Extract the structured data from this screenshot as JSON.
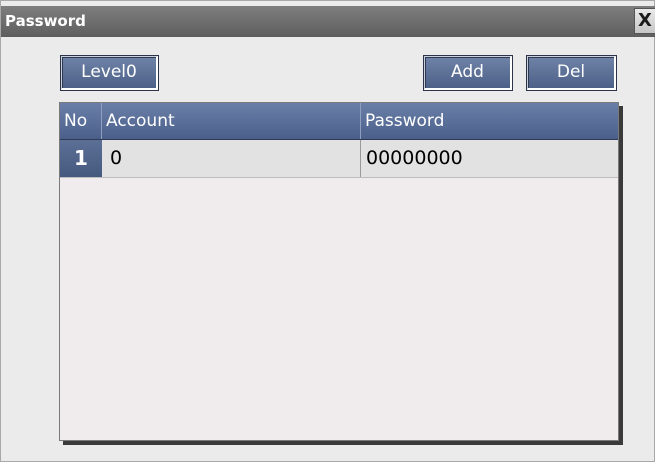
{
  "window": {
    "title": "Password",
    "close_label": "X"
  },
  "toolbar": {
    "level_label": "Level",
    "level_value": "0",
    "add_label": "Add",
    "del_label": "Del"
  },
  "table": {
    "columns": [
      "No",
      "Account",
      "Password"
    ],
    "rows": [
      {
        "no": "1",
        "account": "0",
        "password": "00000000"
      }
    ]
  }
}
